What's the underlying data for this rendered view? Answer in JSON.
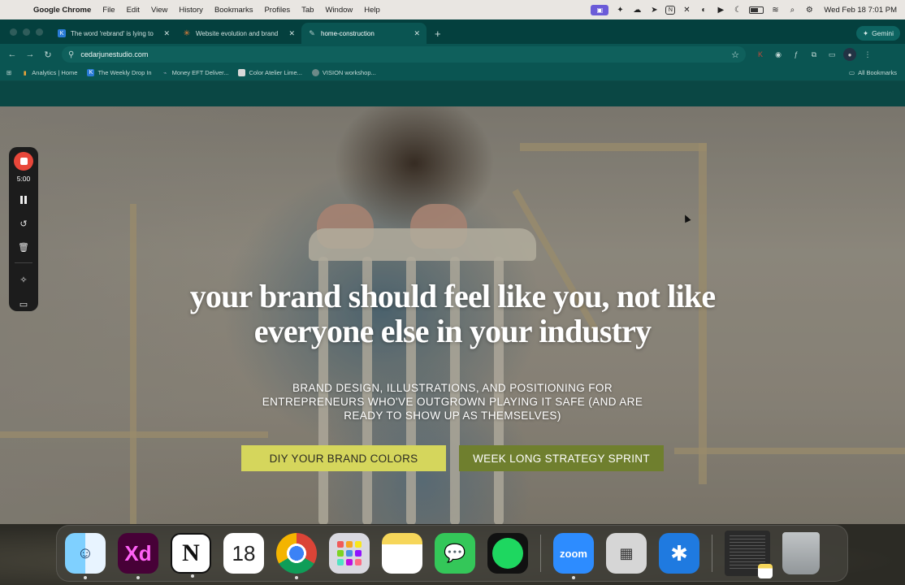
{
  "menubar": {
    "apple": "",
    "items": [
      "Google Chrome",
      "File",
      "Edit",
      "View",
      "History",
      "Bookmarks",
      "Profiles",
      "Tab",
      "Window",
      "Help"
    ],
    "clock": "Wed Feb 18  7:01 PM"
  },
  "tabs": [
    {
      "title": "The word 'rebrand' is lying to",
      "favicon": "k-icon"
    },
    {
      "title": "Website evolution and brand",
      "favicon": "claude-star-icon"
    },
    {
      "title": "home-construction",
      "favicon": "pen-icon",
      "active": true
    }
  ],
  "gemini_label": "Gemini",
  "toolbar": {
    "url": "cedarjunestudio.com"
  },
  "bookmarks": {
    "items": [
      "Analytics | Home",
      "The Weekly Drop In",
      "Money EFT Deliver...",
      "Color Atelier Lime...",
      "VISION workshop..."
    ],
    "all_label": "All Bookmarks"
  },
  "hero": {
    "headline_line1": "your brand should feel like you, not like",
    "headline_line2": "everyone else in your industry",
    "subhead_line1": "BRAND DESIGN, ILLUSTRATIONS, AND POSITIONING FOR",
    "subhead_line2": "ENTREPRENEURS WHO'VE OUTGROWN PLAYING IT SAFE (AND ARE",
    "subhead_line3": "READY TO SHOW UP AS THEMSELVES)",
    "cta_primary": "DIY YOUR BRAND COLORS",
    "cta_secondary": "WEEK LONG STRATEGY SPRINT"
  },
  "recorder": {
    "time": "5:00"
  },
  "dock": {
    "calendar_day": "18",
    "zoom_label": "zoom",
    "xd_label": "Xd",
    "notion_label": "N"
  },
  "colors": {
    "chrome_frame": "#04403e",
    "chrome_toolbar": "#0a5552",
    "site_header": "#0a4744",
    "cta_primary_bg": "#d5d65c",
    "cta_secondary_bg": "#6f7f2e",
    "recorder_stop": "#e8473a"
  }
}
